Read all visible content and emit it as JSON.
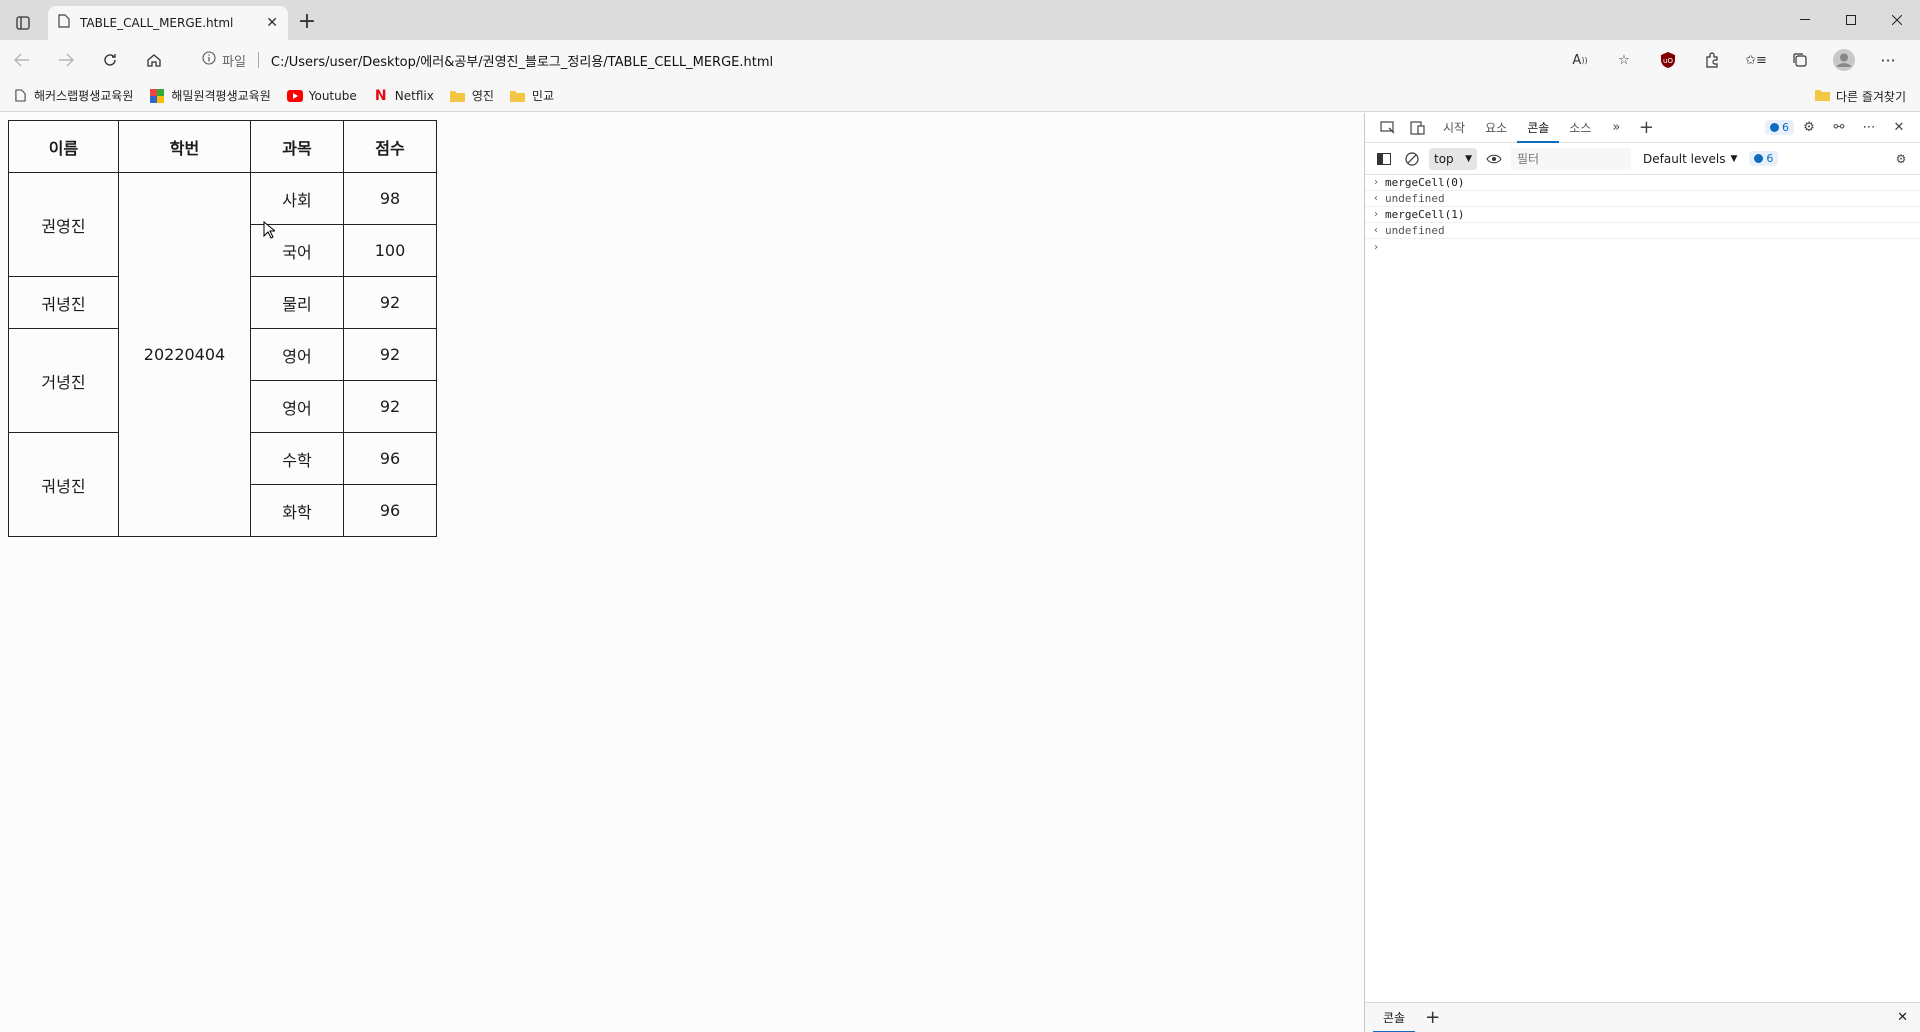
{
  "browser": {
    "tab_title": "TABLE_CALL_MERGE.html",
    "url_scheme": "파일",
    "url": "C:/Users/user/Desktop/에러&공부/권영진_블로그_정리용/TABLE_CELL_MERGE.html"
  },
  "bookmarks": {
    "items": [
      {
        "label": "해커스랩평생교육원",
        "icon": "page-icon"
      },
      {
        "label": "해밀원격평생교육원",
        "icon": "multicolor-icon"
      },
      {
        "label": "Youtube",
        "icon": "youtube-icon",
        "color": "#ff0000"
      },
      {
        "label": "Netflix",
        "icon": "netflix-icon",
        "color": "#e50914"
      },
      {
        "label": "영진",
        "icon": "folder-icon",
        "color": "#f2c744"
      },
      {
        "label": "민교",
        "icon": "folder-icon",
        "color": "#f2c744"
      }
    ],
    "other": "다른 즐겨찾기"
  },
  "table": {
    "headers": [
      "이름",
      "학번",
      "과목",
      "점수"
    ],
    "student_id": "20220404",
    "names": [
      "권영진",
      "궈녕진",
      "거녕진",
      "궈녕진"
    ],
    "rows": [
      {
        "subject": "사회",
        "score": "98"
      },
      {
        "subject": "국어",
        "score": "100"
      },
      {
        "subject": "물리",
        "score": "92"
      },
      {
        "subject": "영어",
        "score": "92"
      },
      {
        "subject": "영어",
        "score": "92"
      },
      {
        "subject": "수학",
        "score": "96"
      },
      {
        "subject": "화학",
        "score": "96"
      }
    ]
  },
  "devtools": {
    "tabs": [
      "시작",
      "요소",
      "콘솔",
      "소스"
    ],
    "active_tab": "콘솔",
    "issue_count": "6",
    "context": "top",
    "filter_placeholder": "필터",
    "levels": "Default levels",
    "levels_count": "6",
    "console": [
      {
        "type": "in",
        "text": "mergeCell(0)"
      },
      {
        "type": "out",
        "text": "undefined"
      },
      {
        "type": "in",
        "text": "mergeCell(1)"
      },
      {
        "type": "out",
        "text": "undefined"
      }
    ],
    "drawer_tab": "콘솔"
  },
  "colors": {
    "accent": "#0f6cbd"
  }
}
